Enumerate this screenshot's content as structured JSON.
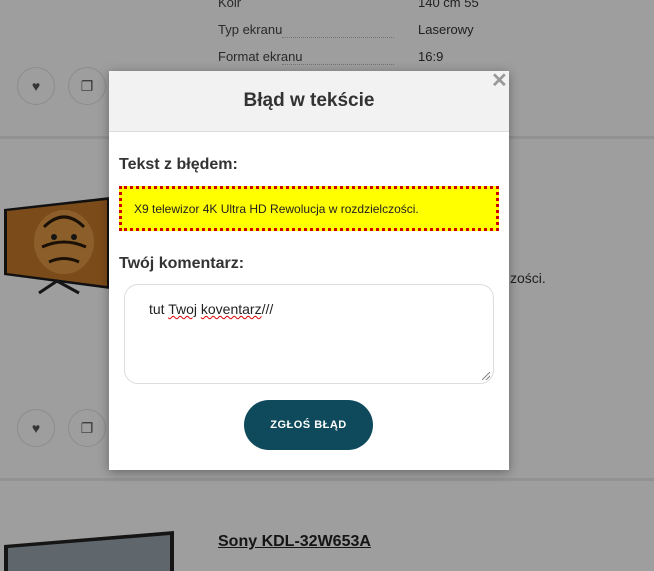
{
  "background": {
    "specs": [
      {
        "label": "Kolr",
        "value": "140 cm 55"
      },
      {
        "label": "Typ ekranu",
        "value": "Laserowy"
      },
      {
        "label": "Format ekranu",
        "value": "16:9"
      }
    ],
    "side_text": "zości.",
    "product_title": "Sony KDL-32W653A",
    "icons": {
      "favorite": "heart-icon",
      "compare": "copy-icon"
    }
  },
  "modal": {
    "title": "Błąd w tekście",
    "error_label": "Tekst z błędem:",
    "error_text": "X9 telewizor 4K Ultra HD Rewolucja w rozdzielczości.",
    "comment_label": "Twój komentarz:",
    "comment_words": [
      "tut ",
      "Twoj",
      " ",
      "koventarz",
      "///"
    ],
    "submit_label": "ZGŁOŚ BŁĄD",
    "close_icon": "close-icon"
  },
  "colors": {
    "highlight": "#ffff00",
    "highlight_border": "#cc0000",
    "button": "#0e4a5c"
  }
}
